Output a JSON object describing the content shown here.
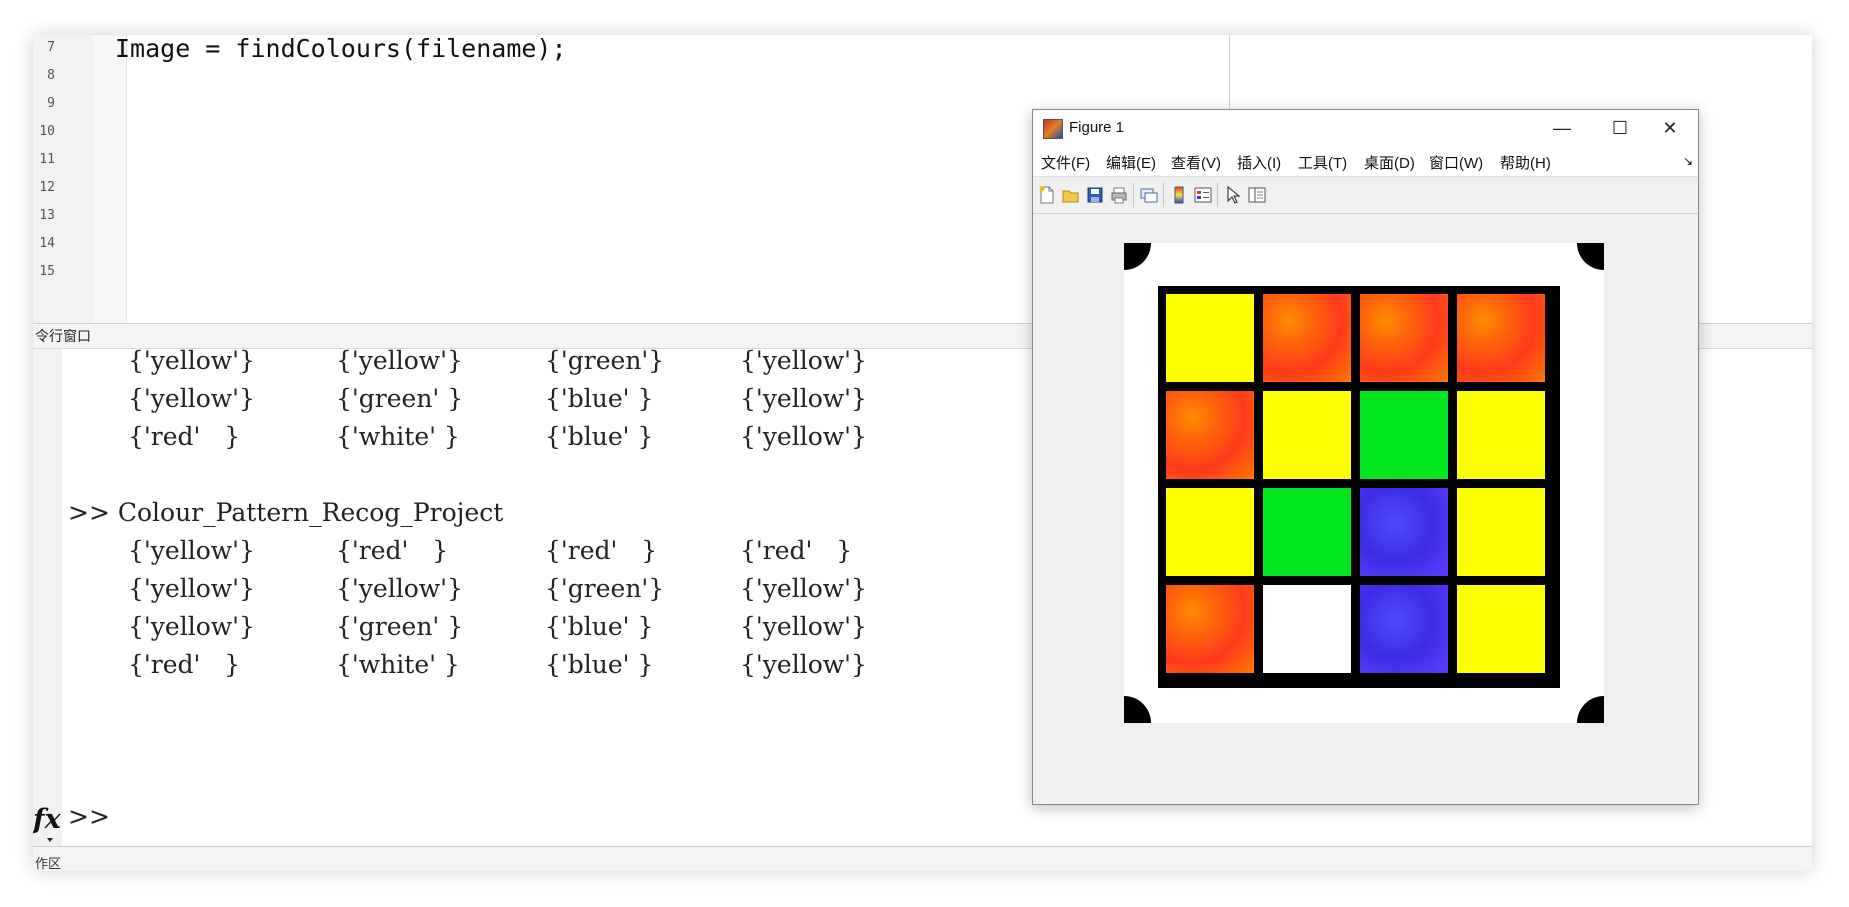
{
  "editor": {
    "line_numbers": [
      "7",
      "8",
      "9",
      "10",
      "11",
      "12",
      "13",
      "14",
      "15"
    ],
    "code_lines": [
      "Image = findColours(filename);"
    ]
  },
  "command_window": {
    "header": "令行窗口",
    "result_before": [
      [
        "{'yellow'}",
        "{'yellow'}",
        "{'green'}",
        "{'yellow'}"
      ],
      [
        "{'yellow'}",
        "{'green' }",
        "{'blue' }",
        "{'yellow'}"
      ],
      [
        "{'red'   }",
        "{'white' }",
        "{'blue' }",
        "{'yellow'}"
      ]
    ],
    "command": ">> Colour_Pattern_Recog_Project",
    "result_after": [
      [
        "{'yellow'}",
        "{'red'   }",
        "{'red'   }",
        "{'red'   }"
      ],
      [
        "{'yellow'}",
        "{'yellow'}",
        "{'green'}",
        "{'yellow'}"
      ],
      [
        "{'yellow'}",
        "{'green' }",
        "{'blue' }",
        "{'yellow'}"
      ],
      [
        "{'red'   }",
        "{'white' }",
        "{'blue' }",
        "{'yellow'}"
      ]
    ],
    "empty_prompt": ">>",
    "fx_label": "fx",
    "bottom_label": "作区"
  },
  "figure": {
    "title": "Figure 1",
    "window_buttons": {
      "minimize": "—",
      "maximize": "☐",
      "close": "✕"
    },
    "menus": [
      "文件(F)",
      "编辑(E)",
      "查看(V)",
      "插入(I)",
      "工具(T)",
      "桌面(D)",
      "窗口(W)",
      "帮助(H)"
    ],
    "menu_overflow": "↘",
    "toolbar_icons": [
      "new-figure-icon",
      "open-file-icon",
      "save-icon",
      "print-icon",
      "link-plot-icon",
      "colorbar-icon",
      "legend-icon",
      "pointer-icon",
      "property-inspector-icon"
    ],
    "grid": [
      [
        "yellow",
        "red",
        "red",
        "red"
      ],
      [
        "red",
        "yellow",
        "green",
        "yellow"
      ],
      [
        "yellow",
        "green",
        "blue",
        "yellow"
      ],
      [
        "red",
        "white",
        "blue",
        "yellow"
      ]
    ],
    "colors": {
      "yellow": "#ffff00",
      "green": "#00e61e",
      "white": "#ffffff",
      "red": "#ff5a10",
      "blue": "#3c2ee6"
    }
  }
}
